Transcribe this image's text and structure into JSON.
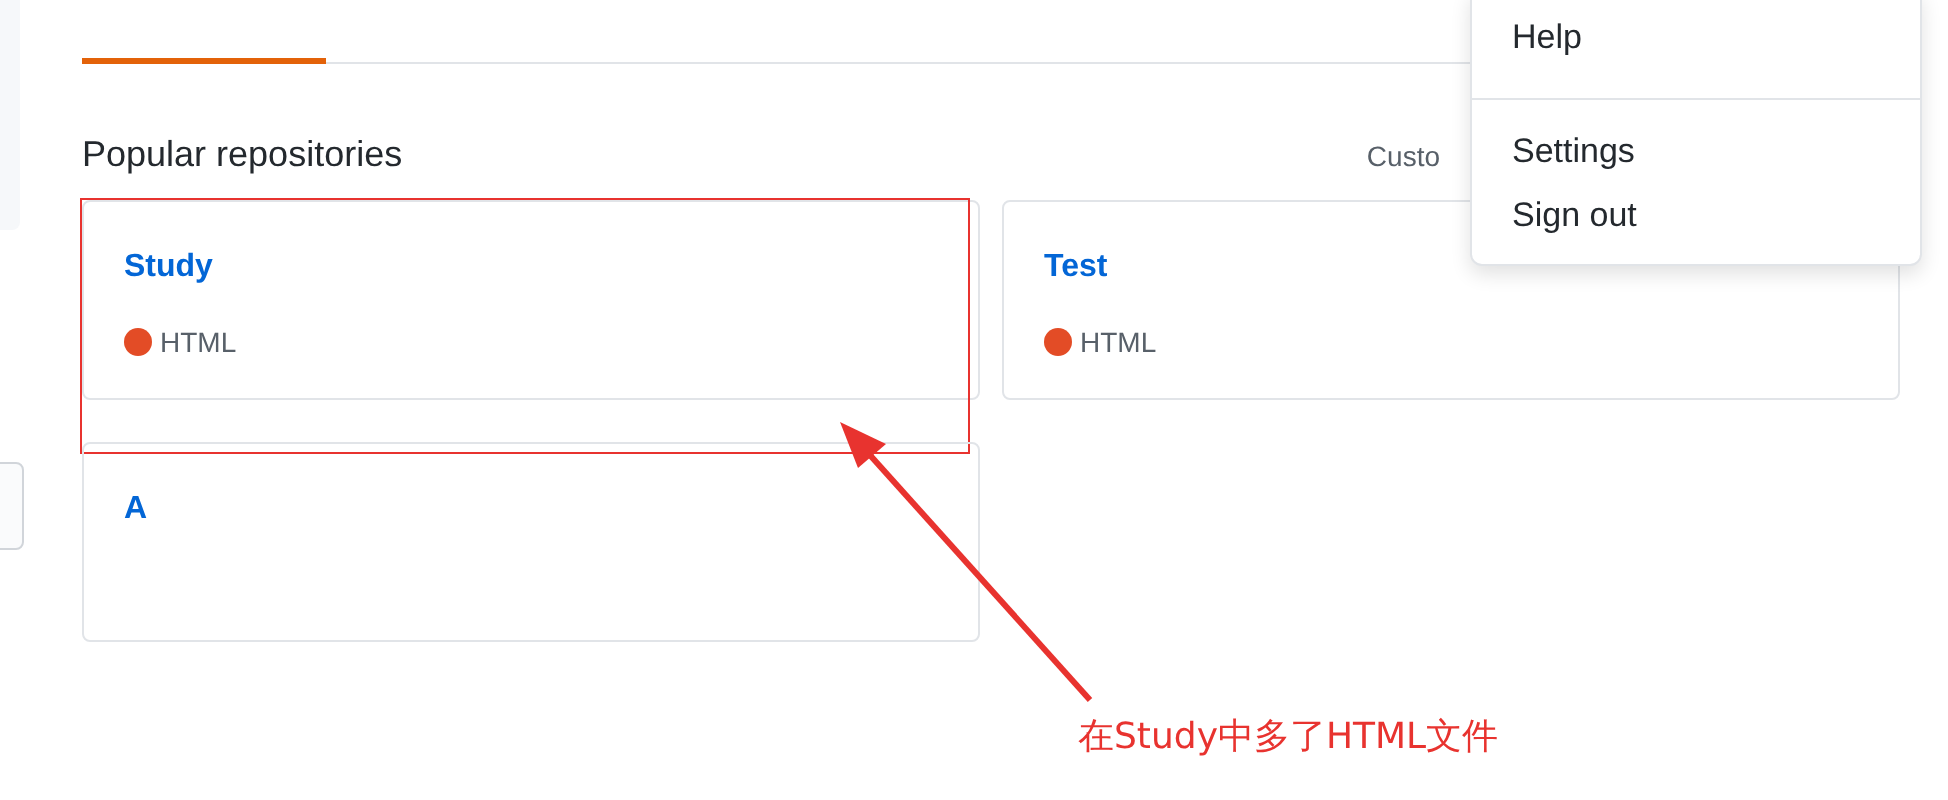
{
  "section_title": "Popular repositories",
  "customize_link": "Custo",
  "repositories": [
    {
      "name": "Study",
      "language": "HTML",
      "color": "#e34c26",
      "highlighted": true
    },
    {
      "name": "Test",
      "language": "HTML",
      "color": "#e34c26",
      "highlighted": false
    },
    {
      "name": "A",
      "highlighted": false
    }
  ],
  "menu": {
    "groups": [
      [
        "Help"
      ],
      [
        "Settings",
        "Sign out"
      ]
    ]
  },
  "annotation": {
    "text": "在Study中多了HTML文件"
  }
}
